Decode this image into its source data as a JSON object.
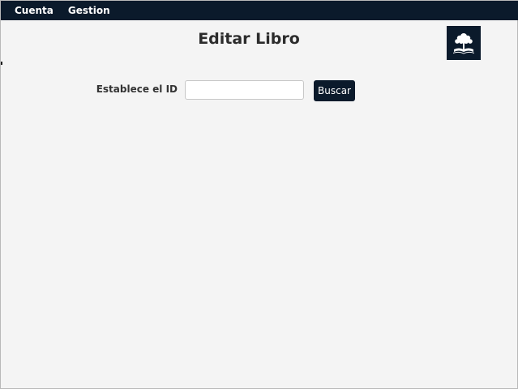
{
  "menubar": {
    "items": [
      {
        "label": "Cuenta"
      },
      {
        "label": "Gestion"
      }
    ]
  },
  "page": {
    "title": "Editar Libro"
  },
  "logo": {
    "icon": "tree-book-logo-icon",
    "background": "#0b1a2b"
  },
  "form": {
    "id_label": "Establece el ID",
    "id_value": "",
    "id_placeholder": "",
    "search_label": "Buscar"
  },
  "colors": {
    "accent": "#0b1a2b",
    "background": "#f4f4f4"
  }
}
